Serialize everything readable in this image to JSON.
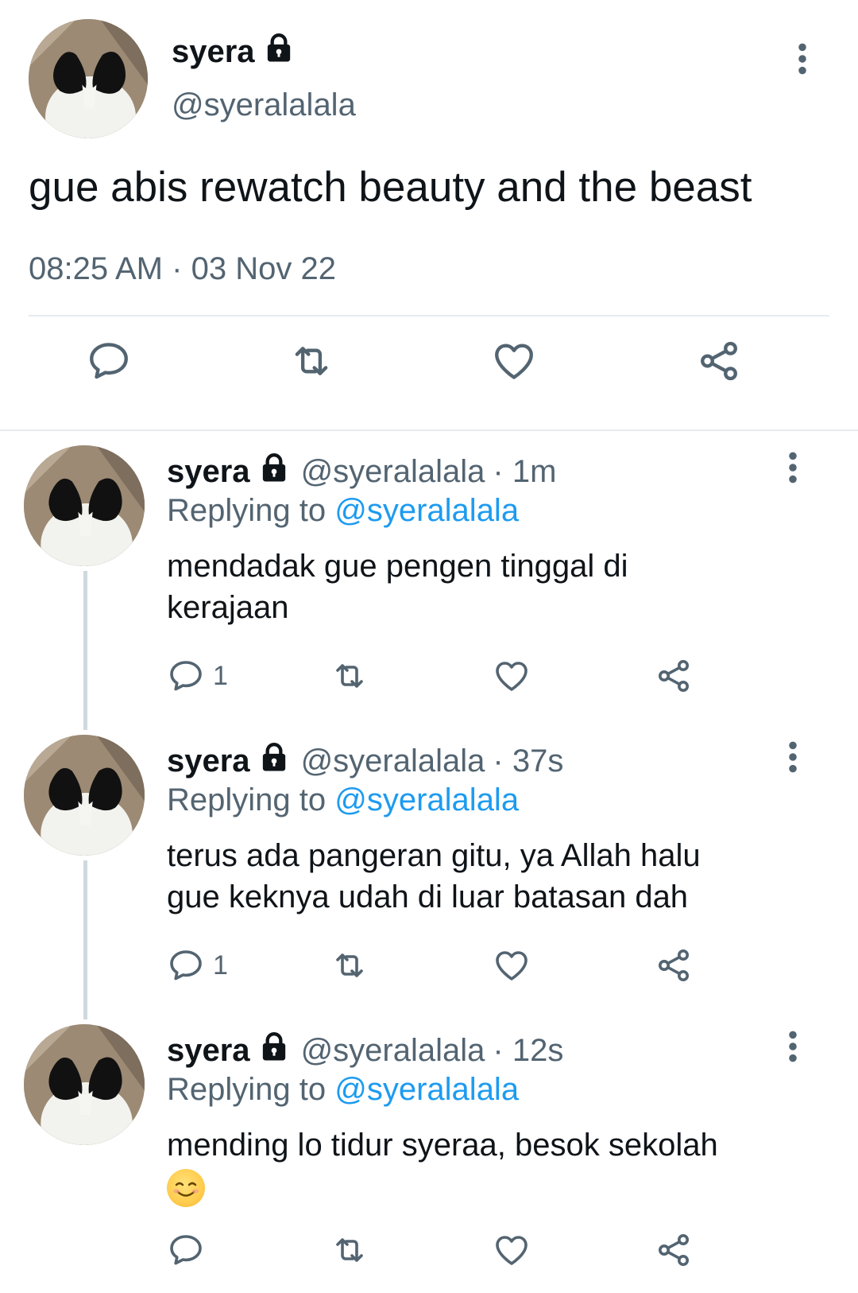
{
  "main_tweet": {
    "display_name": "syera",
    "handle": "@syeralalala",
    "text": "gue abis rewatch beauty and the beast",
    "time": "08:25 AM",
    "separator": "·",
    "date": "03 Nov 22",
    "icons": [
      "reply-icon",
      "retweet-icon",
      "like-icon",
      "share-icon"
    ]
  },
  "replies": [
    {
      "display_name": "syera",
      "handle": "@syeralalala",
      "age": "· 1m",
      "replying_prefix": "Replying to",
      "replying_to": "@syeralalala",
      "text_line1": "mendadak gue pengen tinggal di",
      "text_line2": "kerajaan",
      "reply_count": "1"
    },
    {
      "display_name": "syera",
      "handle": "@syeralalala",
      "age": "· 37s",
      "replying_prefix": "Replying to",
      "replying_to": "@syeralalala",
      "text_line1": "terus ada pangeran gitu, ya Allah halu",
      "text_line2": "gue keknya udah di luar batasan dah",
      "reply_count": "1"
    },
    {
      "display_name": "syera",
      "handle": "@syeralalala",
      "age": "· 12s",
      "replying_prefix": "Replying to",
      "replying_to": "@syeralalala",
      "text_line1": "mending lo tidur syeraa, besok sekolah",
      "text_line2": "",
      "emoji": "smiling-face-emoji",
      "reply_count": ""
    }
  ],
  "colors": {
    "text": "#0f1419",
    "muted": "#536471",
    "link": "#1d9bf0",
    "divider": "#e6ecf0"
  }
}
